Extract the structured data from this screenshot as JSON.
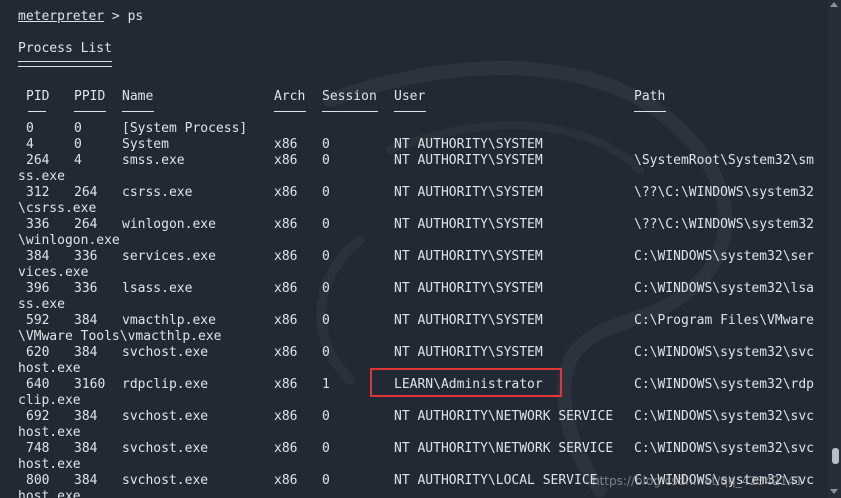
{
  "terminal": {
    "prompt": "meterpreter",
    "command": " > ps",
    "heading": "Process List"
  },
  "columns": {
    "pid": "PID",
    "ppid": "PPID",
    "name": "Name",
    "arch": "Arch",
    "session": "Session",
    "user": "User",
    "path": "Path"
  },
  "rows": [
    {
      "pid": "0",
      "ppid": "0",
      "name": "[System Process]",
      "arch": "",
      "session": "",
      "user": "",
      "path": "",
      "wrap": ""
    },
    {
      "pid": "4",
      "ppid": "0",
      "name": "System",
      "arch": "x86",
      "session": "0",
      "user": "NT AUTHORITY\\SYSTEM",
      "path": "",
      "wrap": ""
    },
    {
      "pid": "264",
      "ppid": "4",
      "name": "smss.exe",
      "arch": "x86",
      "session": "0",
      "user": "NT AUTHORITY\\SYSTEM",
      "path": "\\SystemRoot\\System32\\sm",
      "wrap": "ss.exe"
    },
    {
      "pid": "312",
      "ppid": "264",
      "name": "csrss.exe",
      "arch": "x86",
      "session": "0",
      "user": "NT AUTHORITY\\SYSTEM",
      "path": "\\??\\C:\\WINDOWS\\system32",
      "wrap": "\\csrss.exe"
    },
    {
      "pid": "336",
      "ppid": "264",
      "name": "winlogon.exe",
      "arch": "x86",
      "session": "0",
      "user": "NT AUTHORITY\\SYSTEM",
      "path": "\\??\\C:\\WINDOWS\\system32",
      "wrap": "\\winlogon.exe"
    },
    {
      "pid": "384",
      "ppid": "336",
      "name": "services.exe",
      "arch": "x86",
      "session": "0",
      "user": "NT AUTHORITY\\SYSTEM",
      "path": "C:\\WINDOWS\\system32\\ser",
      "wrap": "vices.exe"
    },
    {
      "pid": "396",
      "ppid": "336",
      "name": "lsass.exe",
      "arch": "x86",
      "session": "0",
      "user": "NT AUTHORITY\\SYSTEM",
      "path": "C:\\WINDOWS\\system32\\lsa",
      "wrap": "ss.exe"
    },
    {
      "pid": "592",
      "ppid": "384",
      "name": "vmacthlp.exe",
      "arch": "x86",
      "session": "0",
      "user": "NT AUTHORITY\\SYSTEM",
      "path": "C:\\Program Files\\VMware",
      "wrap": "\\VMware Tools\\vmacthlp.exe"
    },
    {
      "pid": "620",
      "ppid": "384",
      "name": "svchost.exe",
      "arch": "x86",
      "session": "0",
      "user": "NT AUTHORITY\\SYSTEM",
      "path": "C:\\WINDOWS\\system32\\svc",
      "wrap": "host.exe"
    },
    {
      "pid": "640",
      "ppid": "3160",
      "name": "rdpclip.exe",
      "arch": "x86",
      "session": "1",
      "user": "LEARN\\Administrator",
      "path": "C:\\WINDOWS\\system32\\rdp",
      "wrap": "clip.exe"
    },
    {
      "pid": "692",
      "ppid": "384",
      "name": "svchost.exe",
      "arch": "x86",
      "session": "0",
      "user": "NT AUTHORITY\\NETWORK SERVICE",
      "path": "C:\\WINDOWS\\system32\\svc",
      "wrap": "host.exe"
    },
    {
      "pid": "748",
      "ppid": "384",
      "name": "svchost.exe",
      "arch": "x86",
      "session": "0",
      "user": "NT AUTHORITY\\NETWORK SERVICE",
      "path": "C:\\WINDOWS\\system32\\svc",
      "wrap": "host.exe"
    },
    {
      "pid": "800",
      "ppid": "384",
      "name": "svchost.exe",
      "arch": "x86",
      "session": "0",
      "user": "NT AUTHORITY\\LOCAL SERVICE",
      "path": "C:\\WINDOWS\\system32\\svc",
      "wrap": "host.exe"
    }
  ],
  "watermark": "https://blog.csdn.net/qq_42342141",
  "colors": {
    "background": "#222934",
    "text": "#dfe3e8",
    "highlight": "#e0363a"
  }
}
